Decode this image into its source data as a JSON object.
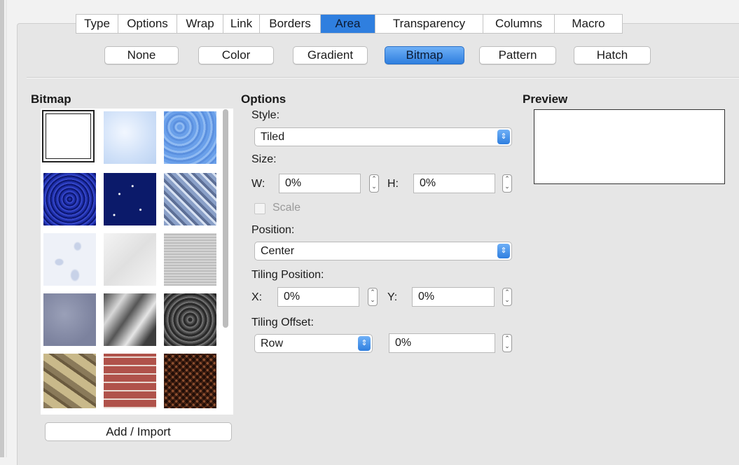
{
  "tabs": [
    {
      "label": "Type"
    },
    {
      "label": "Options"
    },
    {
      "label": "Wrap"
    },
    {
      "label": "Link"
    },
    {
      "label": "Borders"
    },
    {
      "label": "Area",
      "active": true
    },
    {
      "label": "Transparency"
    },
    {
      "label": "Columns"
    },
    {
      "label": "Macro"
    }
  ],
  "fill_types": [
    {
      "label": "None"
    },
    {
      "label": "Color"
    },
    {
      "label": "Gradient"
    },
    {
      "label": "Bitmap",
      "active": true
    },
    {
      "label": "Pattern"
    },
    {
      "label": "Hatch"
    }
  ],
  "bitmap": {
    "heading": "Bitmap",
    "tiles": [
      "blank",
      "sky",
      "water",
      "coarse",
      "night-sky",
      "metal",
      "drops",
      "snow",
      "fabric",
      "marble",
      "chrome",
      "pebbles",
      "stone-wall",
      "brick",
      "weave"
    ],
    "add_import_label": "Add / Import"
  },
  "options": {
    "heading": "Options",
    "style_label": "Style:",
    "style_value": "Tiled",
    "size_label": "Size:",
    "w_label": "W:",
    "w_value": "0%",
    "h_label": "H:",
    "h_value": "0%",
    "scale_label": "Scale",
    "position_label": "Position:",
    "position_value": "Center",
    "tiling_position_label": "Tiling Position:",
    "x_label": "X:",
    "x_value": "0%",
    "y_label": "Y:",
    "y_value": "0%",
    "tiling_offset_label": "Tiling Offset:",
    "offset_type_value": "Row",
    "offset_value": "0%"
  },
  "preview": {
    "heading": "Preview"
  },
  "colors": {
    "accent": "#2f7fdf",
    "background": "#e6e6e6"
  }
}
